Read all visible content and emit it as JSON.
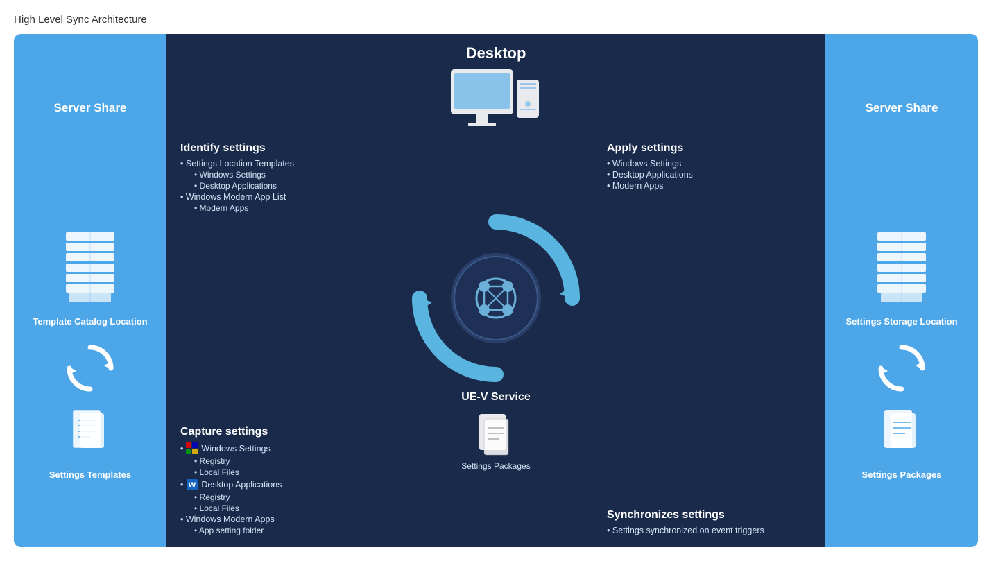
{
  "page": {
    "title": "High Level Sync Architecture"
  },
  "left_share": {
    "header": "Server Share",
    "server_label": "Template Catalog Location",
    "sync_label": "",
    "doc_label": "Settings Templates"
  },
  "right_share": {
    "header": "Server Share",
    "server_label": "Settings Storage Location",
    "sync_label": "",
    "doc_label": "Settings Packages"
  },
  "center": {
    "header": "Desktop",
    "identify": {
      "title": "Identify settings",
      "items": [
        {
          "text": "Settings Location Templates",
          "level": 1
        },
        {
          "text": "Windows Settings",
          "level": 2
        },
        {
          "text": "Desktop Applications",
          "level": 2
        },
        {
          "text": "Windows Modern App List",
          "level": 1
        },
        {
          "text": "Modern Apps",
          "level": 2
        }
      ]
    },
    "apply": {
      "title": "Apply settings",
      "items": [
        {
          "text": "Windows Settings",
          "level": 1
        },
        {
          "text": "Desktop Applications",
          "level": 1
        },
        {
          "text": "Modern Apps",
          "level": 1
        }
      ]
    },
    "capture": {
      "title": "Capture settings",
      "items": [
        {
          "text": "Windows Settings",
          "level": 1
        },
        {
          "text": "Registry",
          "level": 2
        },
        {
          "text": "Local Files",
          "level": 2
        },
        {
          "text": "Desktop Applications",
          "level": 1
        },
        {
          "text": "Registry",
          "level": 2
        },
        {
          "text": "Local Files",
          "level": 2
        },
        {
          "text": "Windows Modern Apps",
          "level": 1
        },
        {
          "text": "App setting folder",
          "level": 2
        }
      ]
    },
    "sync": {
      "title": "Synchronizes settings",
      "items": [
        {
          "text": "Settings synchronized on event triggers",
          "level": 1
        }
      ]
    },
    "uev_label": "UE-V Service",
    "settings_packages_label": "Settings Packages"
  }
}
